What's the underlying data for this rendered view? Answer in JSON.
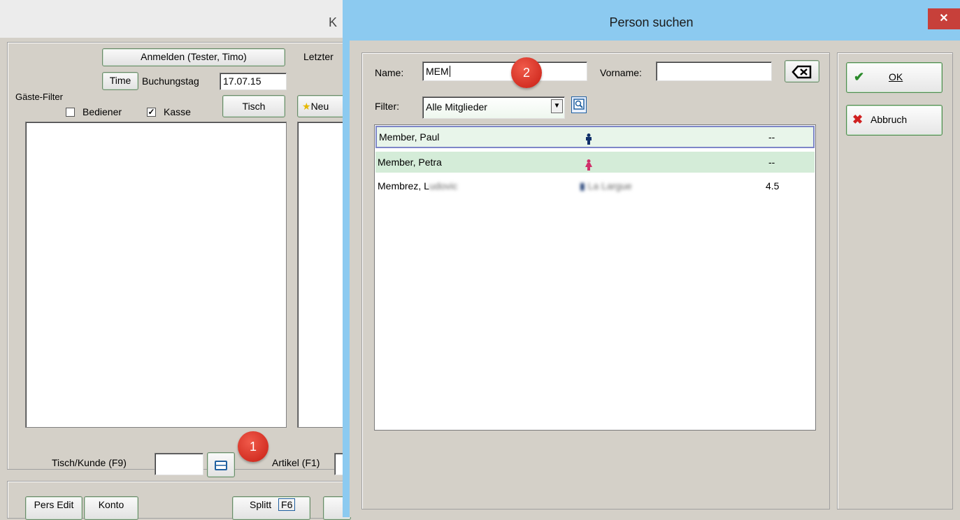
{
  "background_window": {
    "title_fragment": "K",
    "login_button": "Anmelden (Tester, Timo)",
    "time_button": "Time",
    "booking_day_label": "Buchungstag",
    "booking_day_value": "17.07.15",
    "last_label": "Letzter",
    "guest_filter_label": "Gäste-Filter",
    "filter_operator_label": "Bediener",
    "filter_operator_checked": false,
    "filter_register_label": "Kasse",
    "filter_register_checked": true,
    "table_button": "Tisch",
    "new_button": "Neu",
    "table_customer_label": "Tisch/Kunde (F9)",
    "table_customer_value": "",
    "article_label": "Artikel (F1)",
    "pers_edit_button": "Pers Edit",
    "account_button": "Konto",
    "split_button": "Splitt",
    "split_shortcut": "F6",
    "badge_1": "1"
  },
  "dialog": {
    "title": "Person suchen",
    "close_glyph": "✕",
    "name_label": "Name:",
    "name_value": "MEM",
    "firstname_label": "Vorname:",
    "firstname_value": "",
    "badge_2": "2",
    "filter_label": "Filter:",
    "filter_selected": "Alle Mitglieder",
    "ok_button": "OK",
    "cancel_button": "Abbruch",
    "results": [
      {
        "name": "Member, Paul",
        "gender_icon": "male-person-icon",
        "value": "--"
      },
      {
        "name": "Member, Petra",
        "gender_icon": "female-person-icon",
        "value": "--"
      },
      {
        "name": "Membrez, L",
        "name_blurred": "udovic",
        "gender_icon": "male-person-icon",
        "club_blurred": "La Largue",
        "value": "4.5"
      }
    ]
  },
  "colors": {
    "dialog_frame": "#8ccaf0",
    "close_button": "#c7403a",
    "row_selected": "#e8f5ea",
    "row_alt": "#d4ecd8",
    "male_icon": "#10306a",
    "female_icon": "#d0306a",
    "badge": "#d6281c"
  }
}
